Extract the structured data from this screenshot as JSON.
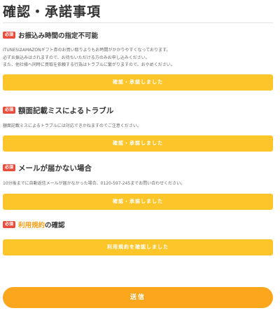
{
  "page": {
    "title": "確認・承諾事項",
    "submit_label": "送信"
  },
  "sections": [
    {
      "badge": "必須",
      "title": "お振込み時間の指定不可能",
      "body": [
        "ITUNESはAMAZONギフト券のお買い取りよりもお時間がかかりやすくなっております。",
        "必ずお振込みはされますので、お待ちいただける方のみお申し込みください。",
        "また、他社様へ同時に買取を依頼する行為はトラブルに繋がりますので、おやめください。"
      ],
      "button_label": "確認・承諾しました"
    },
    {
      "badge": "必須",
      "title": "額面記載ミスによるトラブル",
      "body": [
        "額面記載ミスによるトラブルには対応できかねますのでご注意ください。"
      ],
      "button_label": "確認・承諾しました"
    },
    {
      "badge": "必須",
      "title": "メールが届かない場合",
      "body": [
        "10分後までに自動返信メールが届かなかった場合、0120-597-245までお問い合わせください。"
      ],
      "button_label": "確認・承諾しました"
    },
    {
      "badge": "必須",
      "title_link": "利用規約",
      "title_suffix": "の確認",
      "button_label": "利用規約を確認しました"
    }
  ],
  "colors": {
    "badge": "#e74c3c",
    "button": "#fcc52a",
    "submit": "#fba61d",
    "link": "#f4a11a"
  }
}
